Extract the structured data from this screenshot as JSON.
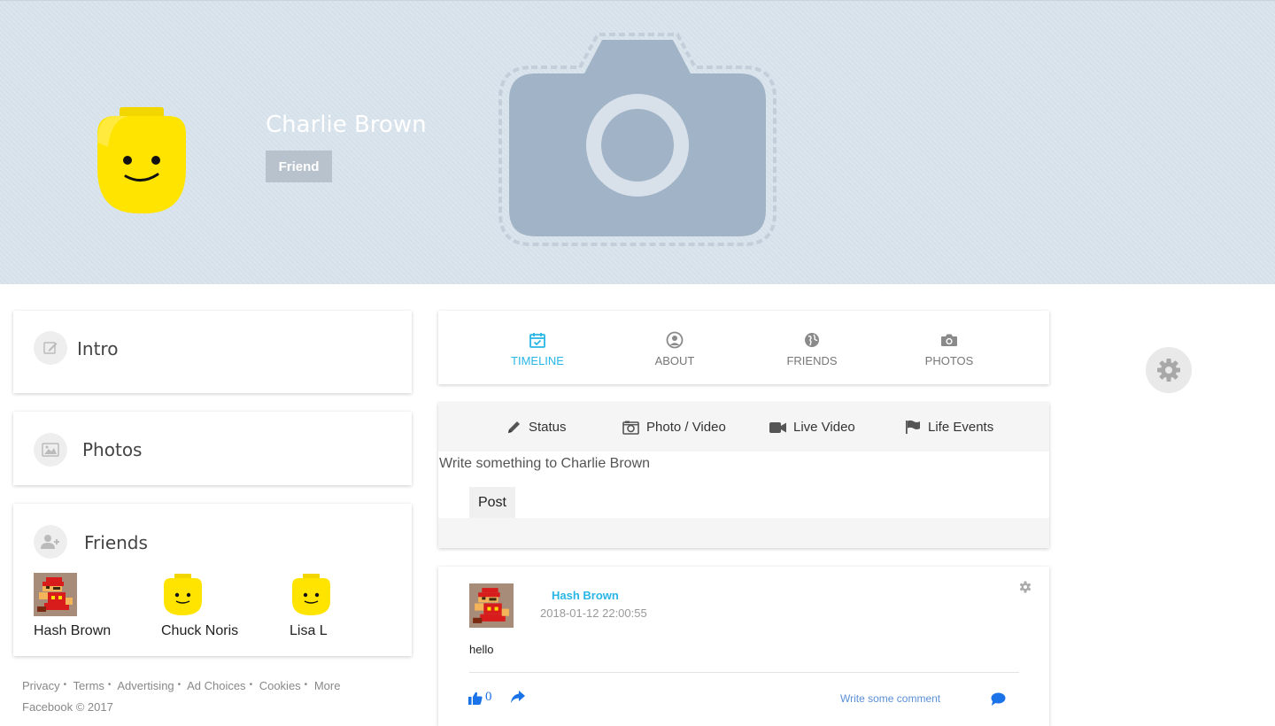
{
  "profile": {
    "name": "Charlie Brown",
    "relationship_button": "Friend"
  },
  "sidebar": {
    "intro_title": "Intro",
    "photos_title": "Photos",
    "friends_title": "Friends",
    "friends": [
      {
        "name": "Hash Brown",
        "avatar": "pixel-mario-avatar"
      },
      {
        "name": "Chuck Noris",
        "avatar": "lego-face-avatar"
      },
      {
        "name": "Lisa L",
        "avatar": "lego-face-avatar"
      }
    ]
  },
  "footer": {
    "links": [
      "Privacy",
      "Terms",
      "Advertising",
      "Ad Choices",
      "Cookies",
      "More"
    ],
    "separator": "•",
    "copyright": "Facebook © 2017"
  },
  "tabs": [
    {
      "label": "TIMELINE",
      "icon": "calendar-check-icon",
      "active": true
    },
    {
      "label": "ABOUT",
      "icon": "user-circle-icon",
      "active": false
    },
    {
      "label": "FRIENDS",
      "icon": "globe-icon",
      "active": false
    },
    {
      "label": "PHOTOS",
      "icon": "camera-icon",
      "active": false
    }
  ],
  "composer": {
    "types": [
      {
        "label": "Status",
        "icon": "pencil-icon"
      },
      {
        "label": "Photo / Video",
        "icon": "photo-camera-icon"
      },
      {
        "label": "Live Video",
        "icon": "video-camera-icon"
      },
      {
        "label": "Life Events",
        "icon": "flag-icon"
      }
    ],
    "placeholder": "Write something to Charlie Brown",
    "post_button": "Post"
  },
  "post": {
    "author": "Hash Brown",
    "timestamp": "2018-01-12 22:00:55",
    "text": "hello",
    "likes": "0",
    "comment_placeholder": "Write some comment"
  },
  "colors": {
    "accent": "#29b6e5",
    "cover_bg": "#d8e3ed",
    "link_blue": "#1a73e8"
  }
}
